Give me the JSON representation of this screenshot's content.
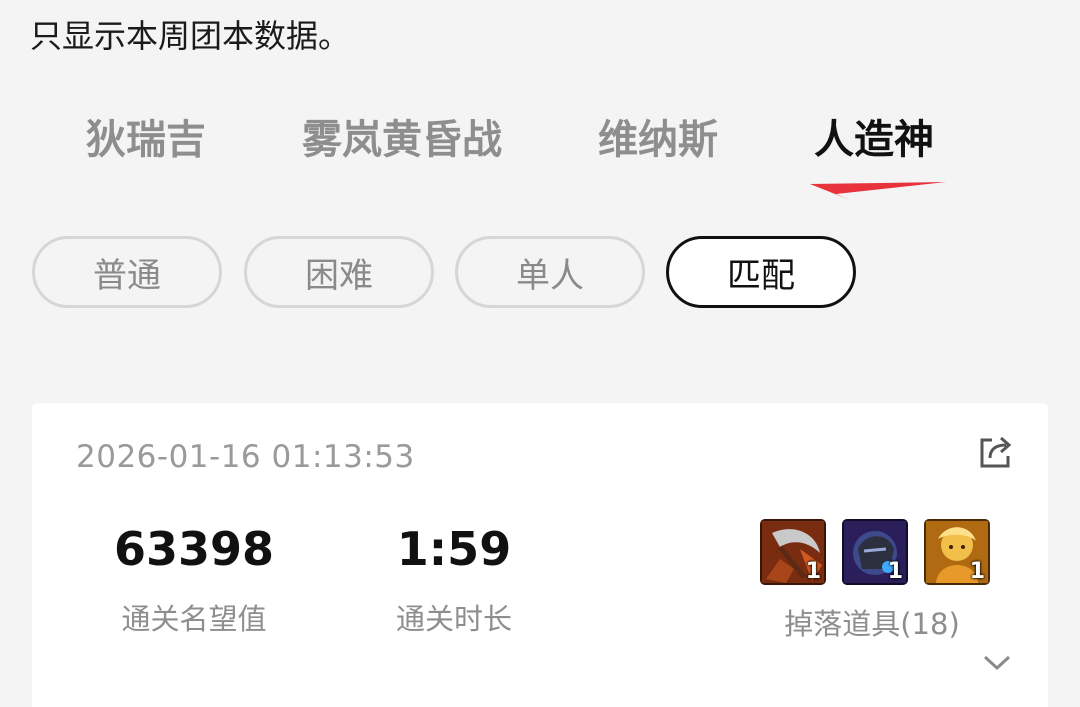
{
  "notice": "只显示本周团本数据。",
  "tabs": [
    {
      "label": "狄瑞吉",
      "active": false
    },
    {
      "label": "雾岚黄昏战",
      "active": false
    },
    {
      "label": "维纳斯",
      "active": false
    },
    {
      "label": "人造神",
      "active": true
    }
  ],
  "modes": [
    {
      "label": "普通",
      "active": false
    },
    {
      "label": "困难",
      "active": false
    },
    {
      "label": "单人",
      "active": false
    },
    {
      "label": "匹配",
      "active": true
    }
  ],
  "record": {
    "timestamp": "2026-01-16 01:13:53",
    "renown": {
      "value": "63398",
      "label": "通关名望值"
    },
    "duration": {
      "value": "1:59",
      "label": "通关时长"
    },
    "drops": {
      "label": "掉落道具(18)",
      "items": [
        {
          "icon": "scythe-weapon-icon",
          "count": "1"
        },
        {
          "icon": "dark-armor-icon",
          "count": "1"
        },
        {
          "icon": "golden-character-icon",
          "count": "1"
        }
      ]
    }
  },
  "colors": {
    "accent": "#e8323c",
    "background": "#f4f4f4",
    "card": "#ffffff"
  }
}
